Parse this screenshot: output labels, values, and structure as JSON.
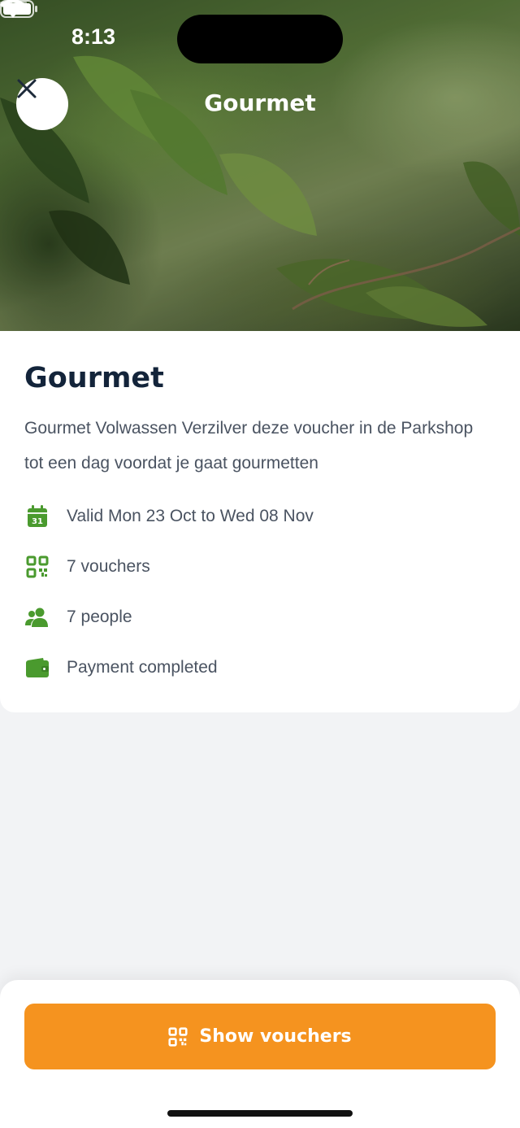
{
  "status_bar": {
    "time": "8:13",
    "icons": [
      "signal-icon",
      "wifi-icon",
      "battery-icon"
    ]
  },
  "header": {
    "title": "Gourmet",
    "close_icon": "close-icon"
  },
  "details": {
    "title": "Gourmet",
    "description": "Gourmet Volwassen Verzilver deze voucher in de Parkshop tot een dag voordat je gaat gourmetten",
    "rows": [
      {
        "icon": "calendar-icon",
        "text": "Valid Mon 23 Oct to Wed 08 Nov"
      },
      {
        "icon": "qr-code-icon",
        "text": "7 vouchers"
      },
      {
        "icon": "people-icon",
        "text": "7 people"
      },
      {
        "icon": "wallet-icon",
        "text": "Payment completed"
      }
    ],
    "calendar_day": "31"
  },
  "footer": {
    "button_label": "Show vouchers",
    "button_icon": "qr-code-icon"
  },
  "colors": {
    "accent_green": "#4a9a2e",
    "button_orange": "#f5931f",
    "title_dark": "#13243a",
    "text_gray": "#4a5361"
  }
}
